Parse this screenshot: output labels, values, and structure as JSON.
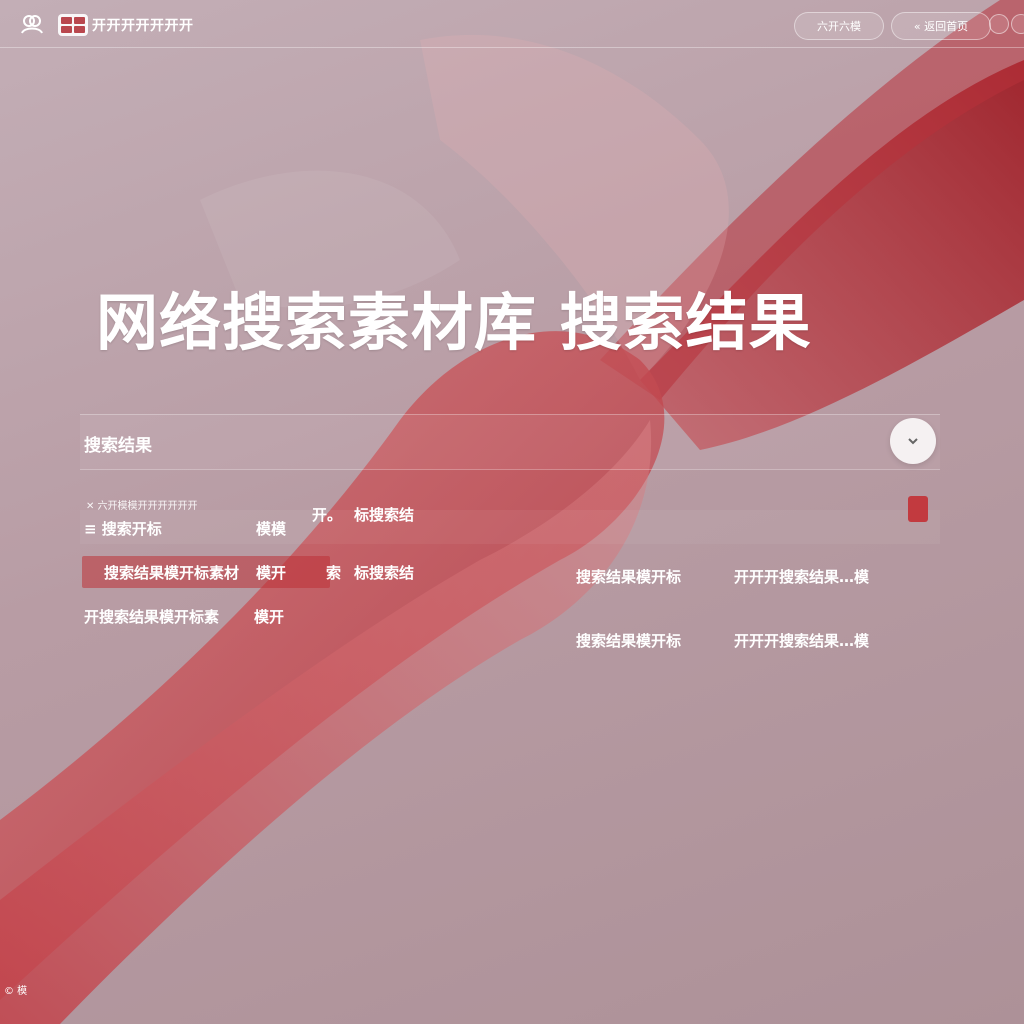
{
  "colors": {
    "accent": "#c23a3f",
    "ribbon": "#b8323a",
    "background": "#b89ca4"
  },
  "header": {
    "brand_name": "开开开开开开开",
    "nav_button_label": "六开六模",
    "back_button_label": "« 返回首页",
    "icons": [
      "user-group-icon",
      "grid-logo-icon",
      "circle-icon",
      "circle-icon"
    ]
  },
  "hero": {
    "title": "网络搜索素材库 搜索结果"
  },
  "panel": {
    "title": "搜索结果",
    "toggle_icon": "collapse-icon"
  },
  "rows": {
    "r0_caption": "✕ 六开模模开开开开开开",
    "r1_col1": "≡ 搜索开标",
    "r1_col2": "模模",
    "r1_col3": "开。",
    "r1_col4": "标搜索结",
    "r2_col1": "搜索结果模开标素材",
    "r2_col2": "模开",
    "r2_col3": "索",
    "r2_col4": "标搜索结",
    "r2_col5": "搜索结果模开标",
    "r2_col6": "开开开搜索结果…模",
    "r3_col1": "开搜索结果模开标素",
    "r3_col2": "模开",
    "r3_col5": "搜索结果模开标",
    "r3_col6": "开开开搜索结果…模"
  },
  "footer": {
    "note": "© 模"
  }
}
